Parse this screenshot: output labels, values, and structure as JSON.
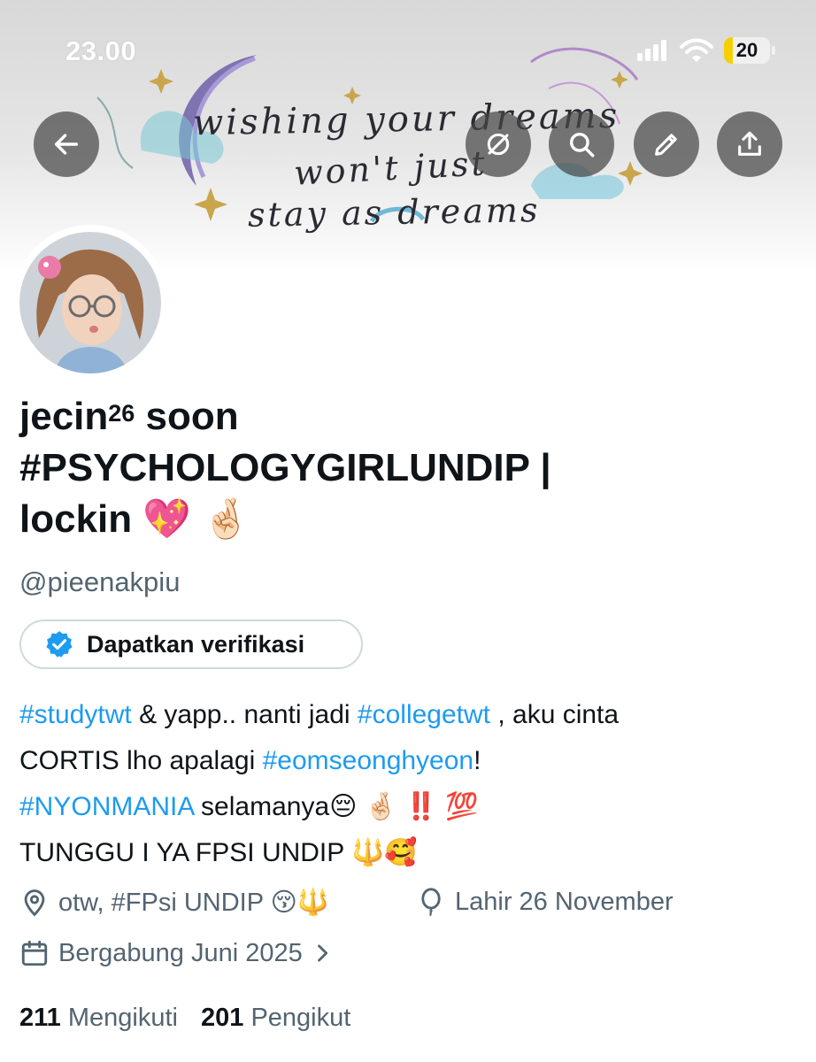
{
  "status_bar": {
    "time": "23.00",
    "battery_level": "20",
    "battery_fraction": 0.2,
    "icons": [
      "cellular-signal-icon",
      "wifi-icon",
      "battery-icon"
    ]
  },
  "banner": {
    "line1": "wishing your dreams",
    "line2": "won't just",
    "line3": "stay as dreams"
  },
  "toolbar": {
    "back_icon": "arrow-left-icon",
    "grok_icon": "grok-icon",
    "search_icon": "search-icon",
    "edit_icon": "pencil-icon",
    "share_icon": "share-icon"
  },
  "profile": {
    "name_prefix": "jecin",
    "name_sup": "26",
    "name_line1_rest": " soon",
    "name_line2": "#PSYCHOLOGYGIRLUNDIP |",
    "name_line3": "lockin 💖 🤞🏻",
    "handle": "@pieenakpiu",
    "verify_label": "Dapatkan verifikasi"
  },
  "bio": {
    "l1_tag1": "#studytwt",
    "l1_text1": " & yapp.. nanti jadi ",
    "l1_tag2": "#collegetwt",
    "l1_text2": " , aku cinta",
    "l2_text1": "CORTIS lho apalagi ",
    "l2_tag": "#eomseonghyeon",
    "l2_text2": "!",
    "l3_tag": "#NYONMANIA",
    "l3_text": " selamanya😔 🤞🏻 ‼️ 💯",
    "l4_text": "TUNGGU I YA FPSI UNDIP 🔱🥰"
  },
  "meta": {
    "location": "otw, #FPsi UNDIP 😚🔱",
    "birthday": "Lahir 26 November",
    "joined": "Bergabung Juni 2025"
  },
  "stats": {
    "following_count": "211",
    "following_label": "Mengikuti",
    "followers_count": "201",
    "followers_label": "Pengikut"
  },
  "colors": {
    "accent": "#1d9bf0",
    "secondary_text": "#536471",
    "primary_text": "#0f1419",
    "battery": "#f5d000"
  }
}
